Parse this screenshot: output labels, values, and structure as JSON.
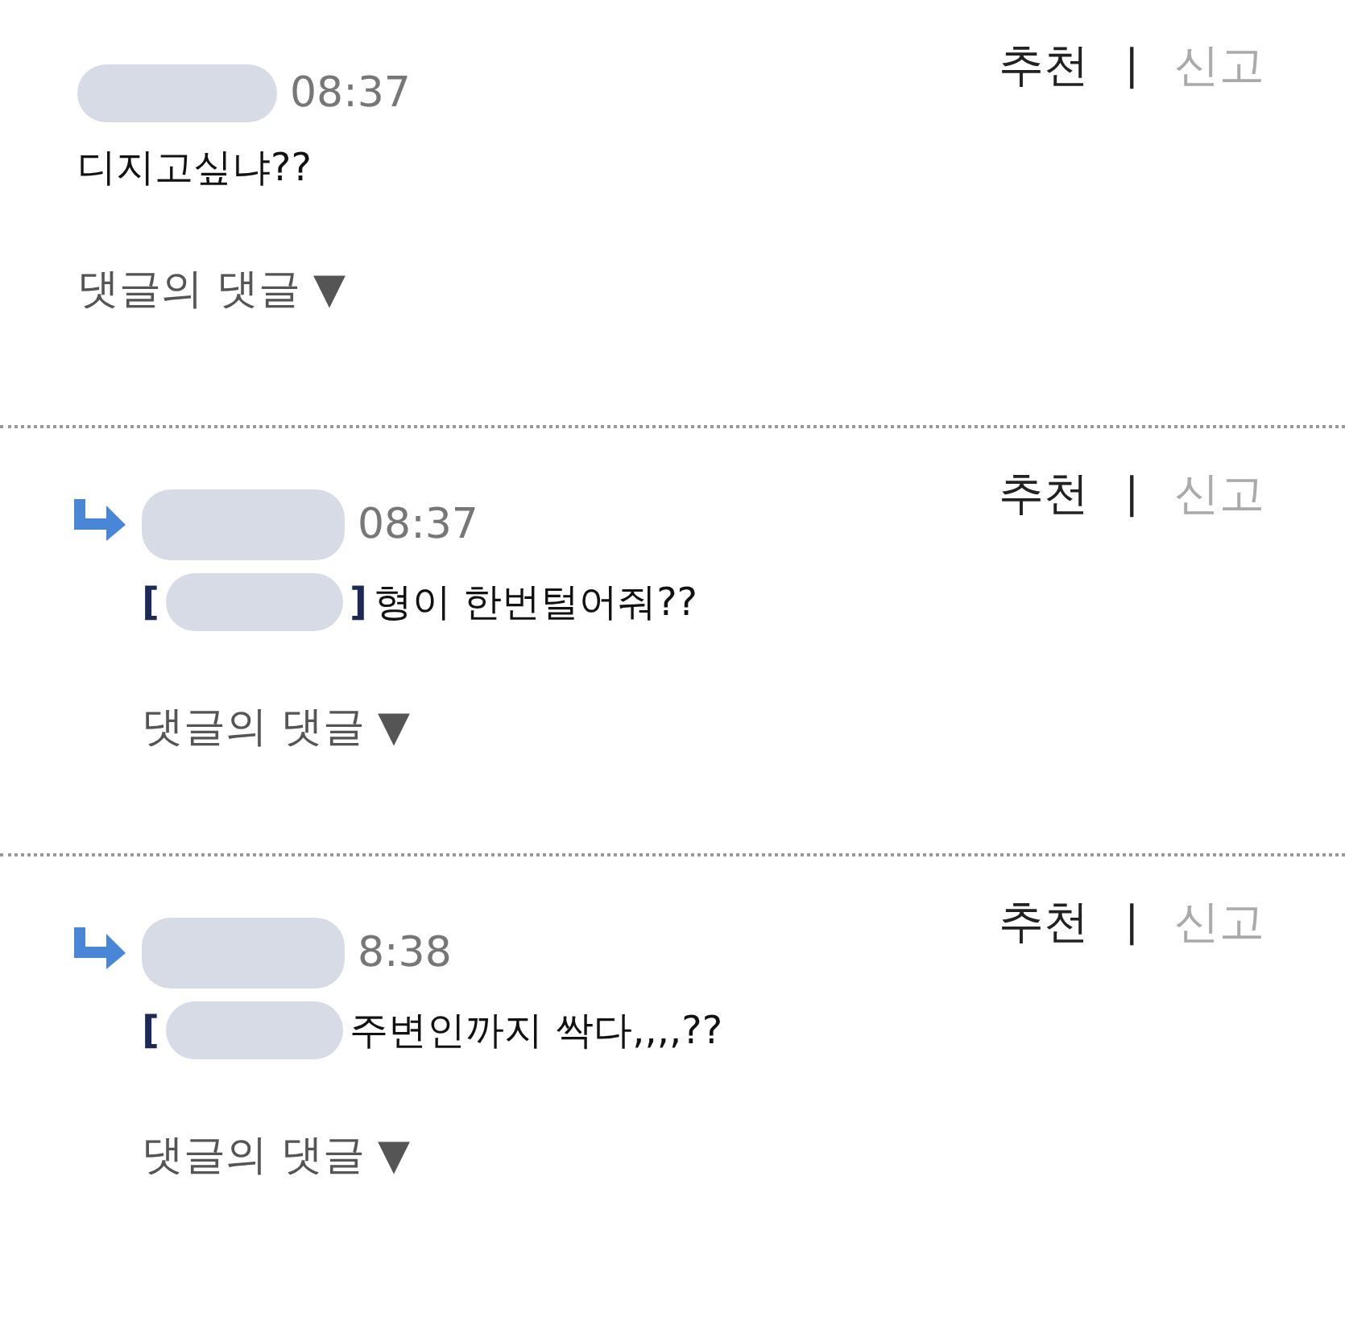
{
  "comments": [
    {
      "kind": "top",
      "time": "08:37",
      "text": "디지고싶냐??",
      "reply_link": "댓글의 댓글",
      "reply_caret": "▼",
      "recommend": "추천",
      "separator": "|",
      "report": "신고"
    },
    {
      "kind": "reply",
      "time": "08:37",
      "mention_brackets": [
        "[",
        "]"
      ],
      "text": "형이 한번털어줘??",
      "reply_link": "댓글의 댓글",
      "reply_caret": "▼",
      "recommend": "추천",
      "separator": "|",
      "report": "신고"
    },
    {
      "kind": "reply",
      "time": "8:38",
      "mention_brackets": [
        "["
      ],
      "text": "주변인까지 싹다,,,,??",
      "reply_link": "댓글의 댓글",
      "reply_caret": "▼",
      "recommend": "추천",
      "separator": "|",
      "report": "신고"
    }
  ]
}
